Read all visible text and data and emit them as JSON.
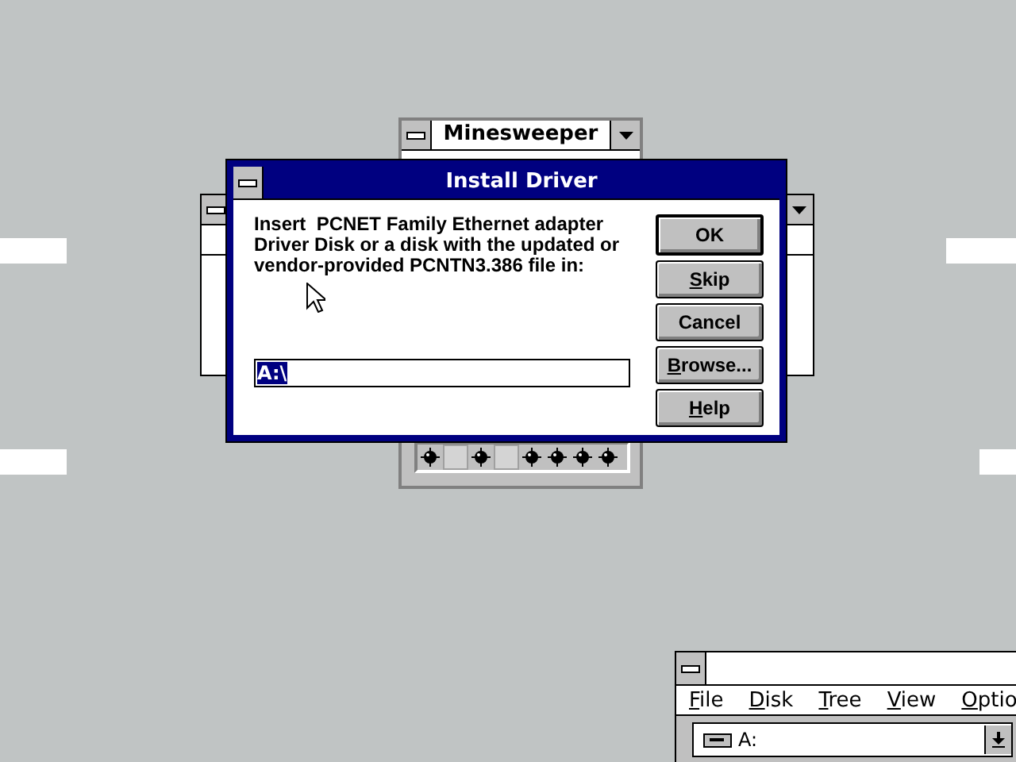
{
  "minesweeper": {
    "title": "Minesweeper",
    "cells": [
      {
        "kind": "mine"
      },
      {
        "kind": "empty"
      },
      {
        "kind": "mine"
      },
      {
        "kind": "empty"
      },
      {
        "kind": "mine"
      },
      {
        "kind": "mine"
      },
      {
        "kind": "mine"
      },
      {
        "kind": "mine"
      }
    ]
  },
  "dialog": {
    "title": "Install Driver",
    "message": "Insert  PCNET Family Ethernet adapter Driver Disk or a disk with the updated or vendor-provided PCNTN3.386 file in:",
    "path": {
      "value": "A:\\",
      "selected": true
    },
    "buttons": [
      {
        "label": "OK",
        "default": true
      },
      {
        "accel": "S",
        "after": "kip",
        "default": false
      },
      {
        "label": "Cancel",
        "default": false
      },
      {
        "accel": "B",
        "after": "rowse...",
        "default": false
      },
      {
        "accel": "H",
        "after": "elp",
        "default": false
      }
    ]
  },
  "file_manager": {
    "menu": [
      {
        "accel": "F",
        "after": "ile"
      },
      {
        "accel": "D",
        "after": "isk"
      },
      {
        "accel": "T",
        "after": "ree"
      },
      {
        "accel": "V",
        "after": "iew"
      },
      {
        "accel": "O",
        "after": "ptio"
      }
    ],
    "drive": "A:"
  }
}
